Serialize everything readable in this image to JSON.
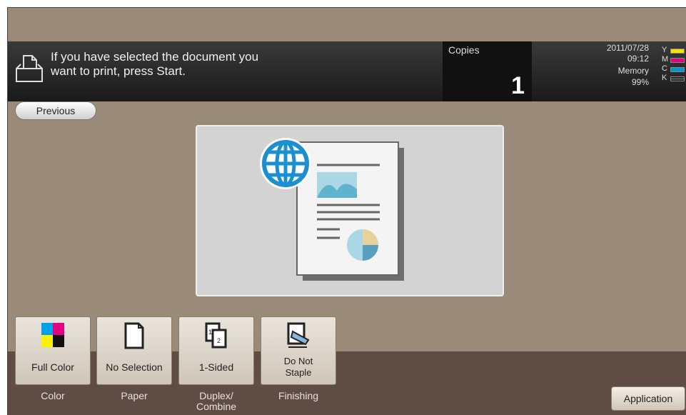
{
  "status": {
    "message_line1": "If you have selected the document you",
    "message_line2": "want to print, press Start.",
    "copies_label": "Copies",
    "copies_value": "1",
    "date": "2011/07/28",
    "time": "09:12",
    "memory_label": "Memory",
    "memory_value": "99%",
    "toner": [
      {
        "letter": "Y",
        "color": "#f5e400"
      },
      {
        "letter": "M",
        "color": "#e6007e"
      },
      {
        "letter": "C",
        "color": "#0096d6"
      },
      {
        "letter": "K",
        "color": "#222222"
      }
    ]
  },
  "nav": {
    "previous_label": "Previous"
  },
  "functions": [
    {
      "value": "Full Color",
      "label": "Color",
      "icon": "color-squares-icon"
    },
    {
      "value": "No Selection",
      "label": "Paper",
      "icon": "paper-sheet-icon"
    },
    {
      "value": "1-Sided",
      "label_line1": "Duplex/",
      "label_line2": "Combine",
      "icon": "duplex-pages-icon"
    },
    {
      "value_line1": "Do Not",
      "value_line2": "Staple",
      "label": "Finishing",
      "icon": "stapler-icon"
    }
  ],
  "application_label": "Application",
  "colors": {
    "background": "#9a8b78",
    "status_bar": "#222222",
    "bottom_band": "#5f4d45"
  }
}
